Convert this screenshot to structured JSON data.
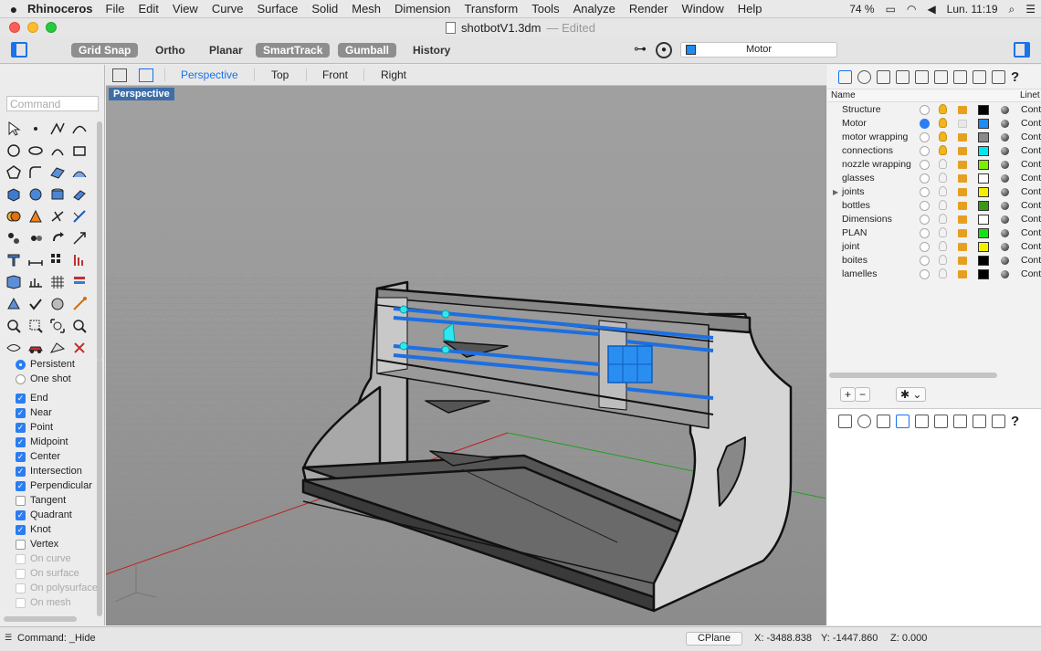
{
  "menubar": {
    "app": "Rhinoceros",
    "items": [
      "File",
      "Edit",
      "View",
      "Curve",
      "Surface",
      "Solid",
      "Mesh",
      "Dimension",
      "Transform",
      "Tools",
      "Analyze",
      "Render",
      "Window",
      "Help"
    ],
    "battery": "74 %",
    "clock": "Lun. 11:19"
  },
  "window": {
    "title": "shotbotV1.3dm",
    "edited": "— Edited"
  },
  "toolbar": {
    "grid_snap": "Grid Snap",
    "ortho": "Ortho",
    "planar": "Planar",
    "smarttrack": "SmartTrack",
    "gumball": "Gumball",
    "history": "History",
    "current_layer": "Motor",
    "current_layer_color": "#1e8cf0"
  },
  "command": {
    "placeholder": "Command"
  },
  "viewport_tabs": {
    "perspective": "Perspective",
    "top": "Top",
    "front": "Front",
    "right": "Right"
  },
  "viewport": {
    "label": "Perspective"
  },
  "osnap": {
    "mode": [
      {
        "label": "Persistent",
        "on": true
      },
      {
        "label": "One shot",
        "on": false
      }
    ],
    "snaps": [
      {
        "label": "End",
        "on": true
      },
      {
        "label": "Near",
        "on": true
      },
      {
        "label": "Point",
        "on": true
      },
      {
        "label": "Midpoint",
        "on": true
      },
      {
        "label": "Center",
        "on": true
      },
      {
        "label": "Intersection",
        "on": true
      },
      {
        "label": "Perpendicular",
        "on": true
      },
      {
        "label": "Tangent",
        "on": false
      },
      {
        "label": "Quadrant",
        "on": true
      },
      {
        "label": "Knot",
        "on": true
      },
      {
        "label": "Vertex",
        "on": false
      },
      {
        "label": "On curve",
        "on": false,
        "disabled": true
      },
      {
        "label": "On surface",
        "on": false,
        "disabled": true
      },
      {
        "label": "On polysurface",
        "on": false,
        "disabled": true
      },
      {
        "label": "On mesh",
        "on": false,
        "disabled": true
      }
    ]
  },
  "layers_panel": {
    "col_name": "Name",
    "col_linetype": "Linet",
    "layers": [
      {
        "name": "Structure",
        "current": false,
        "visible": true,
        "locked": true,
        "color": "#000000"
      },
      {
        "name": "Motor",
        "current": true,
        "visible": true,
        "locked": false,
        "color": "#1e8cf0"
      },
      {
        "name": "motor wrapping",
        "current": false,
        "visible": true,
        "locked": true,
        "color": "#8a8a8a"
      },
      {
        "name": "connections",
        "current": false,
        "visible": true,
        "locked": true,
        "color": "#00e5ee"
      },
      {
        "name": "nozzle wrapping",
        "current": false,
        "visible": false,
        "locked": true,
        "color": "#7cf000"
      },
      {
        "name": "glasses",
        "current": false,
        "visible": false,
        "locked": true,
        "color": "#ffffff"
      },
      {
        "name": "joints",
        "current": false,
        "visible": false,
        "locked": true,
        "color": "#f2f000",
        "expandable": true
      },
      {
        "name": "bottles",
        "current": false,
        "visible": false,
        "locked": true,
        "color": "#3a9a18"
      },
      {
        "name": "Dimensions",
        "current": false,
        "visible": false,
        "locked": true,
        "color": "#ffffff"
      },
      {
        "name": "PLAN",
        "current": false,
        "visible": false,
        "locked": true,
        "color": "#18e018"
      },
      {
        "name": "joint",
        "current": false,
        "visible": false,
        "locked": true,
        "color": "#f2f000"
      },
      {
        "name": "boites",
        "current": false,
        "visible": false,
        "locked": true,
        "color": "#000000"
      },
      {
        "name": "lamelles",
        "current": false,
        "visible": false,
        "locked": true,
        "color": "#000000"
      }
    ],
    "linetype_value": "Cont",
    "add": "+",
    "remove": "−",
    "gear": "✱ ⌄"
  },
  "statusbar": {
    "command": "Command: _Hide",
    "cplane": "CPlane",
    "x": "X: -3488.838",
    "y": "Y: -1447.860",
    "z": "Z: 0.000"
  },
  "icons": [
    "apple-icon",
    "wifi-icon",
    "volume-icon",
    "search-icon",
    "menu-icon",
    "sidebar-toggle-icon",
    "osnap-icon",
    "layers-icon",
    "gear-icon"
  ]
}
